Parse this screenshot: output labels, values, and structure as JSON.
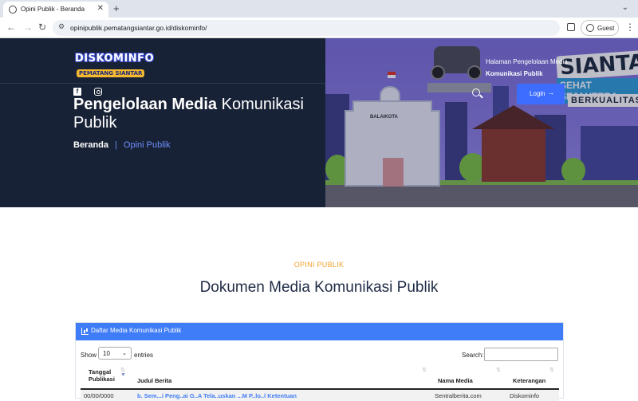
{
  "browser": {
    "tab_title": "Opini Publik - Beranda",
    "url": "opinipublik.pematangsiantar.go.id/diskominfo/",
    "profile_label": "Guest"
  },
  "hero": {
    "logo_line1": "DISKOMINFO",
    "logo_line2": "PEMATANG SIANTAR",
    "title_bold": "Pengelolaan Media",
    "title_rest": " Komunikasi Publik",
    "breadcrumb_home": "Beranda",
    "breadcrumb_sep": "|",
    "breadcrumb_current": "Opini Publik",
    "info_line1": "Halaman Pengelolaan Media",
    "info_line2": "Komunikasi Publik",
    "login_label": "Login",
    "brand_siantar": "SIANTAR",
    "brand_sehat": "SEHAT SEJAHTERA",
    "brand_berkualitas": "BERKUALITAS",
    "building_sign": "BALAIKOTA"
  },
  "section": {
    "kicker": "OPINI PUBLIK",
    "title": "Dokumen Media Komunikasi Publik"
  },
  "table_panel": {
    "header": "Daftar Media Komunikasi Publik",
    "show_label": "Show",
    "length_value": "10",
    "entries_label": "entries",
    "search_label": "Search:",
    "columns": [
      "Tanggal Publikasi",
      "Judul Berita",
      "Nama Media",
      "Keterangan"
    ],
    "rows": [
      {
        "date": "00/00/0000",
        "title": "b. Sem...i Peng..ai G..A Tela..uskan ...M P..lo..l Ketentuan",
        "media": "Sentralberita.com",
        "note": "Diskominfo"
      }
    ]
  }
}
